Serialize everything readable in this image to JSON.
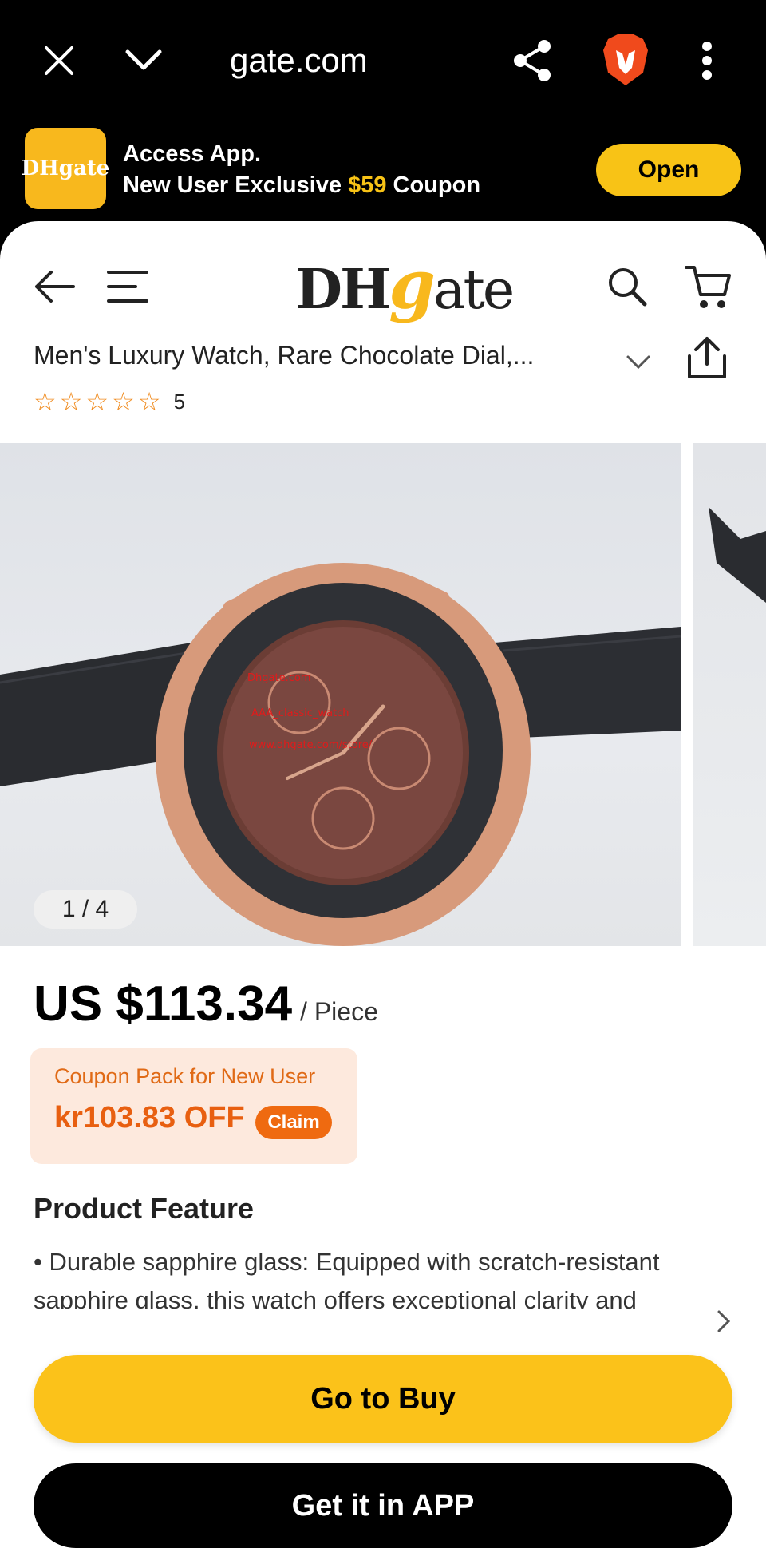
{
  "browser": {
    "url": "gate.com",
    "icons": [
      "close-icon",
      "chevron-down-icon",
      "share-icon",
      "brave-lion-icon",
      "more-vert-icon"
    ]
  },
  "app_banner": {
    "logo_text": "DHgate",
    "line1": "Access App.",
    "line2_prefix": "New User Exclusive ",
    "line2_amount": "$59",
    "line2_suffix": " Coupon",
    "open_label": "Open",
    "accent": "#f8c316"
  },
  "header": {
    "brand_dh": "DH",
    "brand_g": "g",
    "brand_ate": "ate",
    "icons": [
      "back-arrow-icon",
      "menu-icon",
      "search-icon",
      "cart-icon"
    ]
  },
  "product": {
    "title": "Men's Luxury Watch, Rare Chocolate Dial,...",
    "rating": "5",
    "image_counter": "1 / 4",
    "watermark_lines": [
      "Dhgate.com",
      "AAA_classic_watch",
      "www.dhgate.com/store/"
    ]
  },
  "pricing": {
    "price": "US $113.34",
    "unit": "/ Piece"
  },
  "coupon": {
    "label": "Coupon Pack for New User",
    "amount": "kr103.83 OFF",
    "claim": "Claim",
    "color": "#ef6a10"
  },
  "feature": {
    "heading": "Product Feature",
    "body": "• Durable sapphire glass: Equipped with scratch-resistant sapphire glass, this watch offers exceptional clarity and durability, ensuring your timepiece remains"
  },
  "actions": {
    "go_to_buy": "Go to Buy",
    "get_app": "Get it in APP"
  }
}
